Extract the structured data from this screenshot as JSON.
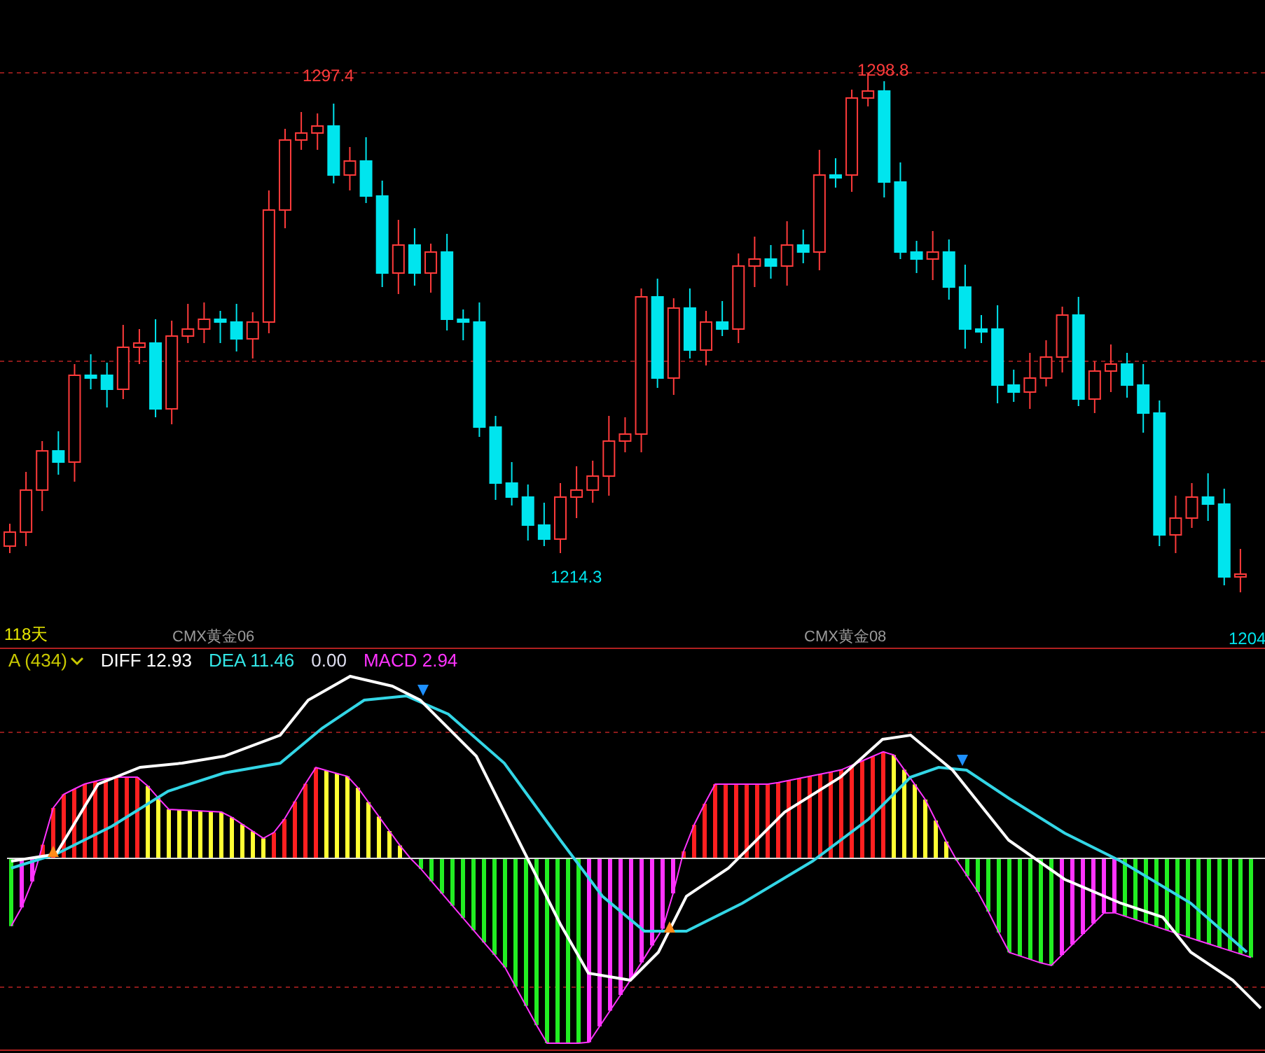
{
  "price_chart": {
    "high_labels": [
      "1297.4",
      "1298.8"
    ],
    "low_label": "1214.3",
    "last_price": "1204",
    "period": "118天",
    "contracts": [
      "CMX黄金06",
      "CMX黄金08"
    ]
  },
  "indicator_bar": {
    "selector": "A (434)",
    "diff": "DIFF 12.93",
    "dea": "DEA 11.46",
    "value": "0.00",
    "macd": "MACD 2.94"
  }
}
